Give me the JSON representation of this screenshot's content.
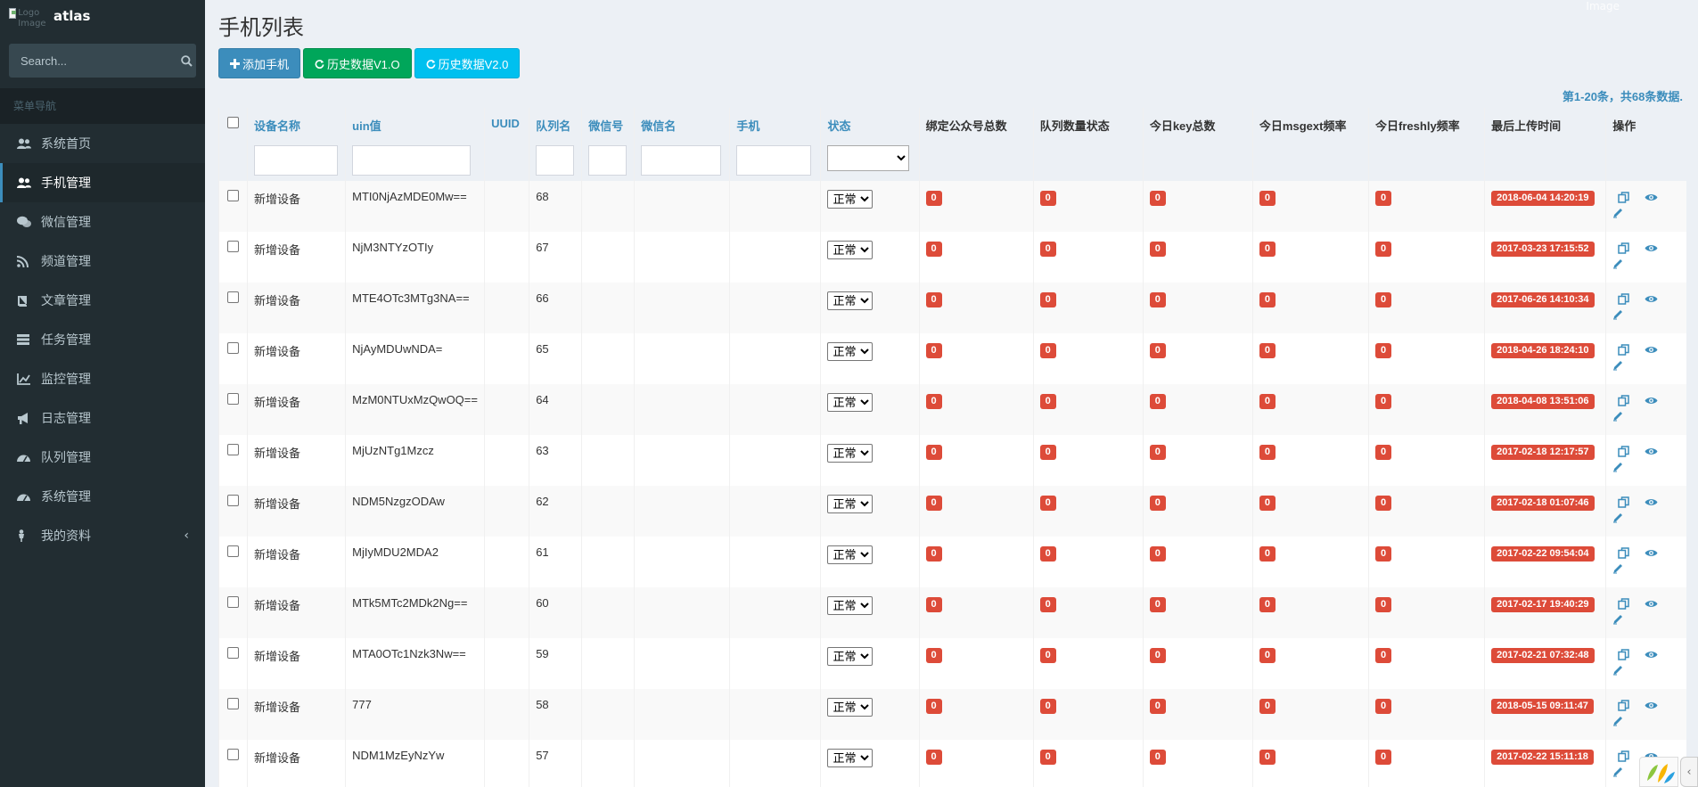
{
  "brand": {
    "name": "atlas",
    "logo_alt": "Logo Image"
  },
  "search": {
    "placeholder": "Search..."
  },
  "sidebar": {
    "header": "菜单导航",
    "items": [
      {
        "label": "系统首页",
        "icon": "users-icon"
      },
      {
        "label": "手机管理",
        "icon": "users-icon"
      },
      {
        "label": "微信管理",
        "icon": "wechat-icon"
      },
      {
        "label": "频道管理",
        "icon": "rss-icon"
      },
      {
        "label": "文章管理",
        "icon": "book-icon"
      },
      {
        "label": "任务管理",
        "icon": "tasks-icon"
      },
      {
        "label": "监控管理",
        "icon": "line-chart-icon"
      },
      {
        "label": "日志管理",
        "icon": "bullhorn-icon"
      },
      {
        "label": "队列管理",
        "icon": "dashboard-icon"
      },
      {
        "label": "系统管理",
        "icon": "dashboard-icon"
      },
      {
        "label": "我的资料",
        "icon": "user-icon"
      }
    ],
    "active_index": 1
  },
  "page": {
    "title": "手机列表"
  },
  "toolbar": {
    "add_label": "添加手机",
    "history_v1_label": "历史数据V1.O",
    "history_v2_label": "历史数据V2.0"
  },
  "pager": {
    "summary": "第1-20条，共68条数据."
  },
  "corner": {
    "note": "Image"
  },
  "table": {
    "columns": {
      "device_name": "设备名称",
      "uin": "uin值",
      "uuid": "UUID",
      "queue": "队列名",
      "wechat_id": "微信号",
      "wechat_name": "微信名",
      "phone": "手机",
      "status": "状态",
      "bind_count": "绑定公众号总数",
      "queue_status": "队列数量状态",
      "key_total": "今日key总数",
      "msgext_rate": "今日msgext频率",
      "freshly_rate": "今日freshly频率",
      "last_upload": "最后上传时间",
      "actions": "操作"
    },
    "rows": [
      {
        "name": "新增设备",
        "uin": "MTI0NjAzMDE0Mw==",
        "queue": "68",
        "status": "正常",
        "bind": "0",
        "qstatus": "0",
        "key": "0",
        "msgext": "0",
        "freshly": "0",
        "last": "2018-06-04 14:20:19"
      },
      {
        "name": "新增设备",
        "uin": "NjM3NTYzOTIy",
        "queue": "67",
        "status": "正常",
        "bind": "0",
        "qstatus": "0",
        "key": "0",
        "msgext": "0",
        "freshly": "0",
        "last": "2017-03-23 17:15:52"
      },
      {
        "name": "新增设备",
        "uin": "MTE4OTc3MTg3NA==",
        "queue": "66",
        "status": "正常",
        "bind": "0",
        "qstatus": "0",
        "key": "0",
        "msgext": "0",
        "freshly": "0",
        "last": "2017-06-26 14:10:34"
      },
      {
        "name": "新增设备",
        "uin": "NjAyMDUwNDA=",
        "queue": "65",
        "status": "正常",
        "bind": "0",
        "qstatus": "0",
        "key": "0",
        "msgext": "0",
        "freshly": "0",
        "last": "2018-04-26 18:24:10"
      },
      {
        "name": "新增设备",
        "uin": "MzM0NTUxMzQwOQ==",
        "queue": "64",
        "status": "正常",
        "bind": "0",
        "qstatus": "0",
        "key": "0",
        "msgext": "0",
        "freshly": "0",
        "last": "2018-04-08 13:51:06"
      },
      {
        "name": "新增设备",
        "uin": "MjUzNTg1Mzcz",
        "queue": "63",
        "status": "正常",
        "bind": "0",
        "qstatus": "0",
        "key": "0",
        "msgext": "0",
        "freshly": "0",
        "last": "2017-02-18 12:17:57"
      },
      {
        "name": "新增设备",
        "uin": "NDM5NzgzODAw",
        "queue": "62",
        "status": "正常",
        "bind": "0",
        "qstatus": "0",
        "key": "0",
        "msgext": "0",
        "freshly": "0",
        "last": "2017-02-18 01:07:46"
      },
      {
        "name": "新增设备",
        "uin": "MjIyMDU2MDA2",
        "queue": "61",
        "status": "正常",
        "bind": "0",
        "qstatus": "0",
        "key": "0",
        "msgext": "0",
        "freshly": "0",
        "last": "2017-02-22 09:54:04"
      },
      {
        "name": "新增设备",
        "uin": "MTk5MTc2MDk2Ng==",
        "queue": "60",
        "status": "正常",
        "bind": "0",
        "qstatus": "0",
        "key": "0",
        "msgext": "0",
        "freshly": "0",
        "last": "2017-02-17 19:40:29"
      },
      {
        "name": "新增设备",
        "uin": "MTA0OTc1Nzk3Nw==",
        "queue": "59",
        "status": "正常",
        "bind": "0",
        "qstatus": "0",
        "key": "0",
        "msgext": "0",
        "freshly": "0",
        "last": "2017-02-21 07:32:48"
      },
      {
        "name": "新增设备",
        "uin": "777",
        "queue": "58",
        "status": "正常",
        "bind": "0",
        "qstatus": "0",
        "key": "0",
        "msgext": "0",
        "freshly": "0",
        "last": "2018-05-15 09:11:47"
      },
      {
        "name": "新增设备",
        "uin": "NDM1MzEyNzYw",
        "queue": "57",
        "status": "正常",
        "bind": "0",
        "qstatus": "0",
        "key": "0",
        "msgext": "0",
        "freshly": "0",
        "last": "2017-02-22 15:11:18"
      }
    ]
  },
  "colors": {
    "sidebar_bg": "#222d32",
    "accent": "#3c8dbc",
    "danger": "#dd4b39",
    "success": "#00a65a",
    "info": "#00c0ef"
  }
}
